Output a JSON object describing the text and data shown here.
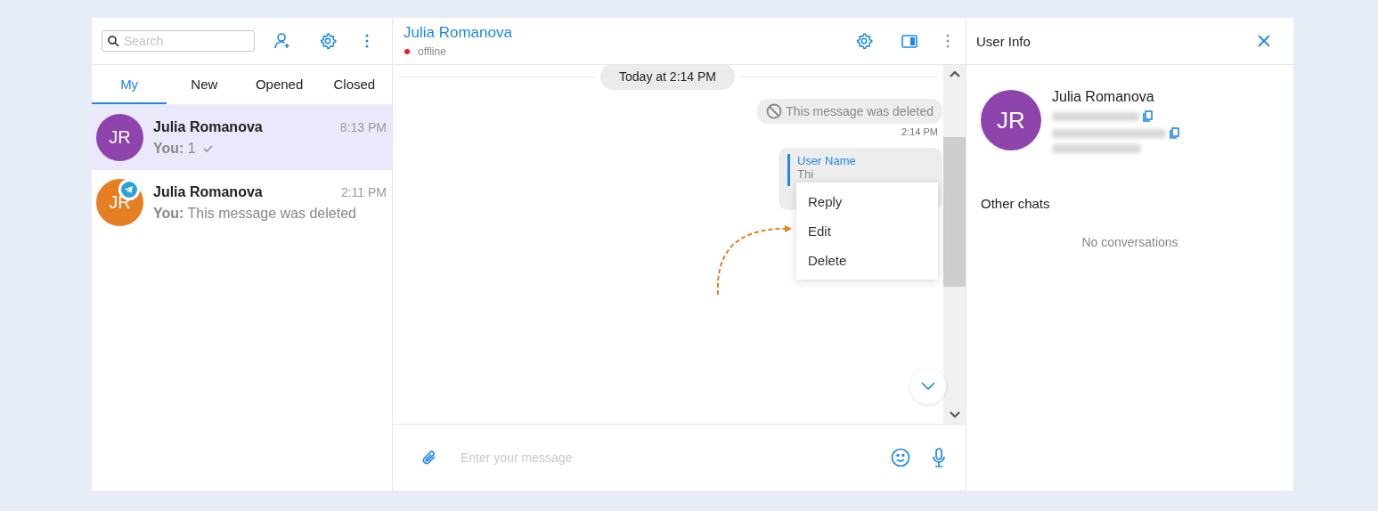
{
  "sidebar": {
    "search": {
      "placeholder": "Search"
    },
    "tabs": [
      {
        "label": "My",
        "selected": true
      },
      {
        "label": "New",
        "selected": false
      },
      {
        "label": "Opened",
        "selected": false
      },
      {
        "label": "Closed",
        "selected": false
      }
    ],
    "chats": [
      {
        "initials": "JR",
        "color": "#8e44ad",
        "name": "Julia Romanova",
        "time": "8:13 PM",
        "sender": "You:",
        "preview": "1",
        "delivered": true,
        "channel_badge": false,
        "selected": true
      },
      {
        "initials": "JR",
        "color": "#e67e22",
        "name": "Julia Romanova",
        "time": "2:11 PM",
        "sender": "You:",
        "preview": "This message was deleted",
        "delivered": false,
        "channel_badge": true,
        "selected": false
      }
    ]
  },
  "chat": {
    "title": "Julia Romanova",
    "status": "offline",
    "online": false,
    "date_divider": "Today at 2:14 PM",
    "messages": [
      {
        "kind": "deleted",
        "text": "This message was deleted",
        "time": "2:14 PM"
      },
      {
        "kind": "reply",
        "quote_author": "User Name",
        "quote_text": "Thi"
      }
    ],
    "context_menu": [
      "Reply",
      "Edit",
      "Delete"
    ],
    "composer": {
      "placeholder": "Enter your message"
    }
  },
  "user_info": {
    "title": "User Info",
    "initials": "JR",
    "color": "#8e44ad",
    "name": "Julia Romanova",
    "other_chats_title": "Other chats",
    "empty_text": "No conversations"
  }
}
